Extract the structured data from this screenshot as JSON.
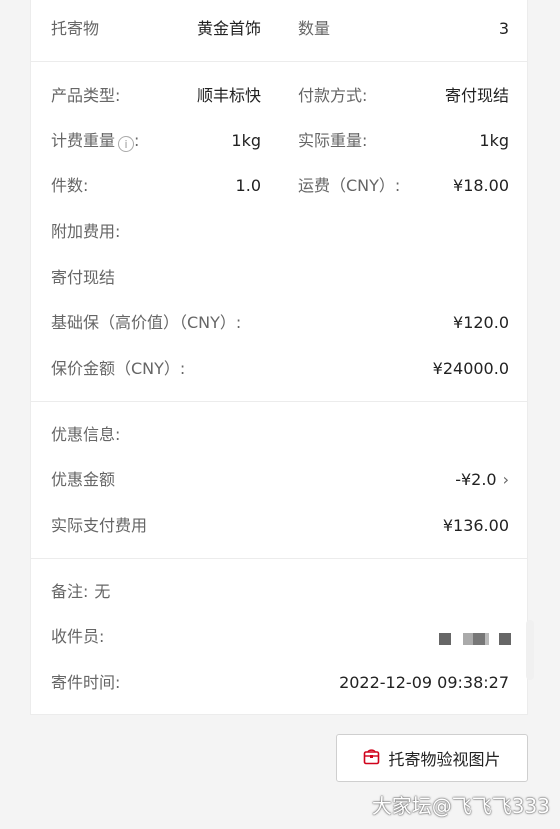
{
  "top_row": {
    "item_label": "托寄物",
    "item_value": "黄金首饰",
    "qty_label": "数量",
    "qty_value": "3"
  },
  "details": {
    "product_type_label": "产品类型:",
    "product_type_value": "顺丰标快",
    "payment_label": "付款方式:",
    "payment_value": "寄付现结",
    "billed_weight_label": "计费重量",
    "billed_weight_colon": ":",
    "billed_weight_value": "1kg",
    "info_icon": "i",
    "actual_weight_label": "实际重量:",
    "actual_weight_value": "1kg",
    "pieces_label": "件数:",
    "pieces_value": "1.0",
    "freight_label": "运费（CNY）:",
    "freight_value": "¥18.00",
    "extra_fee_label": "附加费用:",
    "pay_method_text": "寄付现结",
    "insurance_label": "基础保（高价值）（CNY）:",
    "insurance_value": "¥120.0",
    "declared_label": "保价金额（CNY）:",
    "declared_value": "¥24000.0"
  },
  "discount": {
    "info_label": "优惠信息:",
    "amount_label": "优惠金额",
    "amount_value": "-¥2.0",
    "paid_label": "实际支付费用",
    "paid_value": "¥136.00"
  },
  "extra": {
    "remark_label": "备注:",
    "remark_value": "无",
    "courier_label": "收件员:",
    "time_label": "寄件时间:",
    "time_value": "2022-12-09 09:38:27"
  },
  "action": {
    "button_label": "托寄物验视图片",
    "icon": "package-icon"
  },
  "watermark": "大家坛@飞飞飞333",
  "colors": {
    "brand_red": "#d0021b"
  }
}
